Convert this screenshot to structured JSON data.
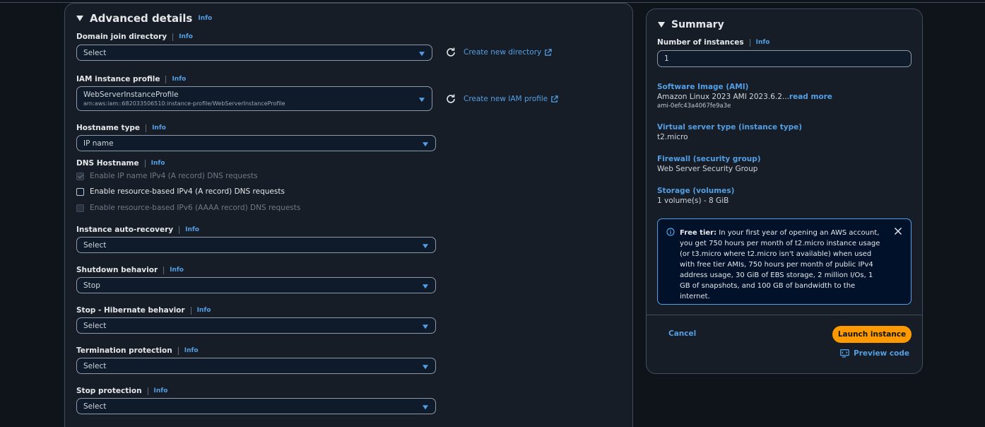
{
  "advanced": {
    "title": "Advanced details",
    "info": "Info",
    "domain": {
      "label": "Domain join directory",
      "value": "Select",
      "link": "Create new directory"
    },
    "iam": {
      "label": "IAM instance profile",
      "value": "WebServerInstanceProfile",
      "sub": "arn:aws:iam::682033506510:instance-profile/WebServerInstanceProfile",
      "link": "Create new IAM profile"
    },
    "hostname": {
      "label": "Hostname type",
      "value": "IP name"
    },
    "dns": {
      "label": "DNS Hostname",
      "opt1": "Enable IP name IPv4 (A record) DNS requests",
      "opt2": "Enable resource-based IPv4 (A record) DNS requests",
      "opt3": "Enable resource-based IPv6 (AAAA record) DNS requests"
    },
    "autorecovery": {
      "label": "Instance auto-recovery",
      "value": "Select"
    },
    "shutdown": {
      "label": "Shutdown behavior",
      "value": "Stop"
    },
    "hibernate": {
      "label": "Stop - Hibernate behavior",
      "value": "Select"
    },
    "termination": {
      "label": "Termination protection",
      "value": "Select"
    },
    "stopprot": {
      "label": "Stop protection",
      "value": "Select"
    }
  },
  "summary": {
    "title": "Summary",
    "info": "Info",
    "instances_label": "Number of instances",
    "instances_value": "1",
    "ami_label": "Software Image (AMI)",
    "ami_value": "Amazon Linux 2023 AMI 2023.6.2...",
    "ami_readmore": "read more",
    "ami_id": "ami-0efc43a4067fe9a3e",
    "type_label": "Virtual server type (instance type)",
    "type_value": "t2.micro",
    "firewall_label": "Firewall (security group)",
    "firewall_value": "Web Server Security Group",
    "storage_label": "Storage (volumes)",
    "storage_value": "1 volume(s) - 8 GiB",
    "freetier_title": "Free tier:",
    "freetier_text": " In your first year of opening an AWS account, you get 750 hours per month of t2.micro instance usage (or t3.micro where t2.micro isn't available) when used with free tier AMIs, 750 hours per month of public IPv4 address usage, 30 GiB of EBS storage, 2 million I/Os, 1 GB of snapshots, and 100 GB of bandwidth to the internet.",
    "cancel": "Cancel",
    "launch": "Launch instance",
    "preview": "Preview code"
  },
  "colors": {
    "accent": "#539fe5",
    "launch": "#ff9900",
    "background": "#0f141a",
    "panel": "#161d26"
  }
}
